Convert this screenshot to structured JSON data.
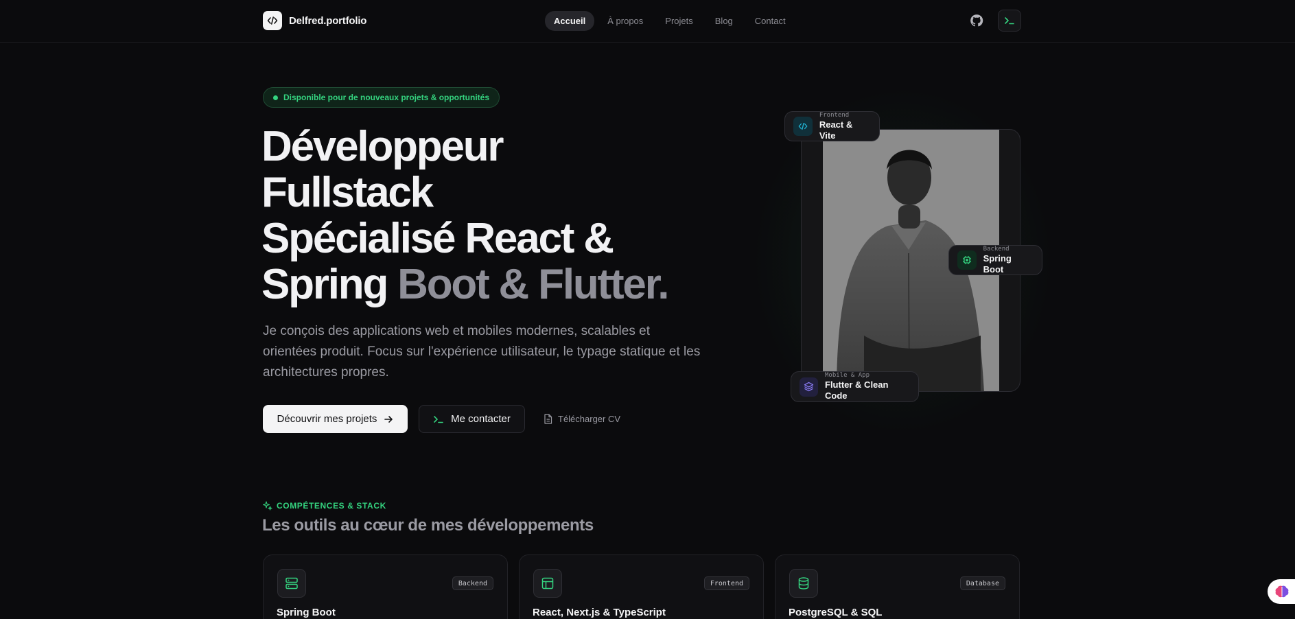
{
  "nav": {
    "logo_text": "Delfred.portfolio",
    "links": [
      {
        "label": "Accueil",
        "active": true
      },
      {
        "label": "À propos",
        "active": false
      },
      {
        "label": "Projets",
        "active": false
      },
      {
        "label": "Blog",
        "active": false
      },
      {
        "label": "Contact",
        "active": false
      }
    ],
    "icons": {
      "github": "github-icon",
      "terminal": "terminal-icon"
    }
  },
  "hero": {
    "badge": "Disponible pour de nouveaux projets & opportunités",
    "headline_line1": "Développeur",
    "headline_line2": "Fullstack",
    "headline_line3": "Spécialisé React &",
    "headline_line4_a": "Spring ",
    "headline_line4_b": "Boot & Flutter.",
    "subtext": "Je conçois des applications web et mobiles modernes, scalables et orientées produit. Focus sur l'expérience utilisateur, le typage statique et les architectures propres.",
    "btn_primary": "Découvrir mes projets",
    "btn_secondary": "Me contacter",
    "btn_cv": "Télécharger CV"
  },
  "photo_pills": [
    {
      "small": "Frontend",
      "big": "React & Vite",
      "color": "#22b8d8"
    },
    {
      "small": "Backend",
      "big": "Spring Boot",
      "color": "#34d37f"
    },
    {
      "small": "Mobile & App",
      "big": "Flutter & Clean Code",
      "color": "#8b7cf6"
    }
  ],
  "skills": {
    "tag": "COMPÉTENCES & STACK",
    "title": "Les outils au cœur de mes développements",
    "cards": [
      {
        "tag": "Backend",
        "title": "Spring Boot"
      },
      {
        "tag": "Frontend",
        "title": "React, Next.js & TypeScript"
      },
      {
        "tag": "Database",
        "title": "PostgreSQL & SQL"
      }
    ]
  },
  "colors": {
    "accent": "#34d37f",
    "bg": "#0b0b0d",
    "cyan": "#22b8d8",
    "violet": "#8b7cf6"
  }
}
